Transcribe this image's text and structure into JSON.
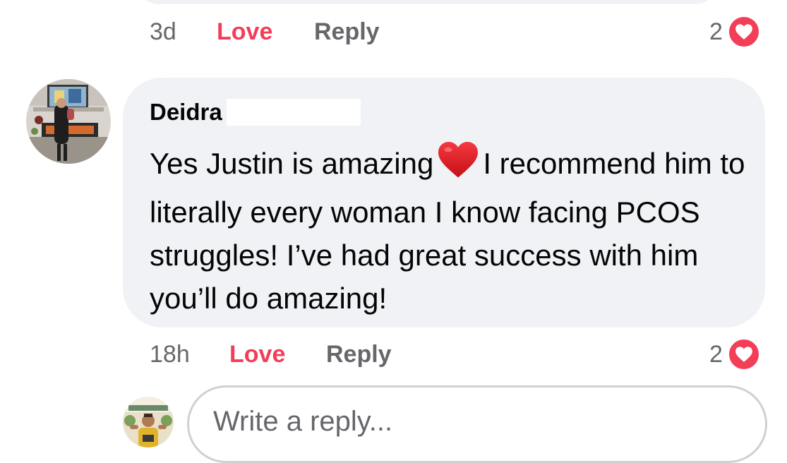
{
  "previous_comment": {
    "time": "3d",
    "love_label": "Love",
    "reply_label": "Reply",
    "reaction_count": "2"
  },
  "comment": {
    "author": "Deidra",
    "text_before_emoji": "Yes Justin is amazing",
    "emoji": "red-heart",
    "text_after_emoji": "I recommend him to literally every woman I know facing PCOS struggles! I’ve had great success with him you’ll do amazing!",
    "time": "18h",
    "love_label": "Love",
    "reply_label": "Reply",
    "reaction_count": "2"
  },
  "reply_composer": {
    "placeholder": "Write a reply..."
  },
  "colors": {
    "bubble": "#f0f2f5",
    "love": "#f33e58",
    "secondary_text": "#65676b",
    "heart_badge": "#f33e58"
  }
}
